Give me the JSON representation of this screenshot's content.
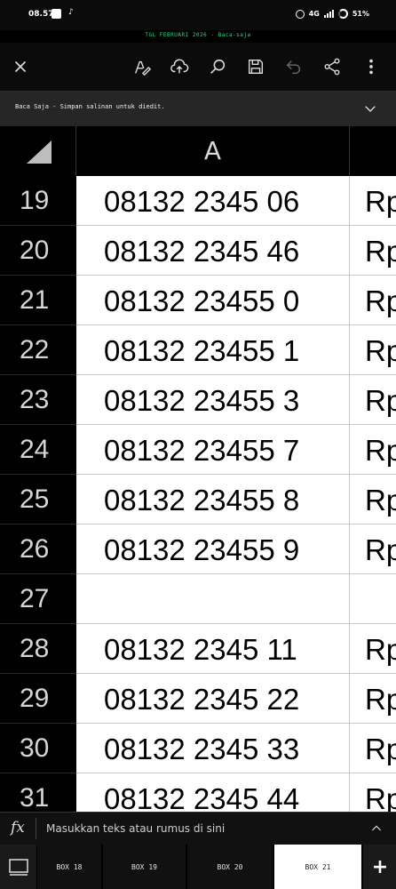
{
  "status_bar": {
    "time": "08.57",
    "network": "4G",
    "battery": "51%"
  },
  "doc_title": "TGL FEBRUARI 2026 - Baca-saja",
  "info_bar": {
    "text": "Baca Saja - Simpan salinan untuk diedit."
  },
  "sheet": {
    "column_header": "A",
    "rows": [
      {
        "num": "19",
        "a": "08132 2345 06",
        "b": "Rp"
      },
      {
        "num": "20",
        "a": "08132 2345 46",
        "b": "Rp"
      },
      {
        "num": "21",
        "a": "08132 23455 0",
        "b": "Rp"
      },
      {
        "num": "22",
        "a": "08132 23455 1",
        "b": "Rp"
      },
      {
        "num": "23",
        "a": "08132 23455 3",
        "b": "Rp"
      },
      {
        "num": "24",
        "a": "08132 23455 7",
        "b": "Rp"
      },
      {
        "num": "25",
        "a": "08132 23455 8",
        "b": "Rp"
      },
      {
        "num": "26",
        "a": "08132 23455 9",
        "b": "Rp"
      },
      {
        "num": "27",
        "a": "",
        "b": ""
      },
      {
        "num": "28",
        "a": "08132 2345 11",
        "b": "Rp"
      },
      {
        "num": "29",
        "a": "08132 2345 22",
        "b": "Rp"
      },
      {
        "num": "30",
        "a": "08132 2345 33",
        "b": "Rp"
      },
      {
        "num": "31",
        "a": "08132 2345 44",
        "b": "Rp"
      }
    ]
  },
  "formula_bar": {
    "icon_label": "fx",
    "placeholder": "Masukkan teks atau rumus di sini"
  },
  "tabs": [
    {
      "label": "BOX 18",
      "active": false
    },
    {
      "label": "BOX 19",
      "active": false
    },
    {
      "label": "BOX 20",
      "active": false
    },
    {
      "label": "BOX 21",
      "active": true
    }
  ],
  "add_sheet_label": "+",
  "colors": {
    "title_green": "#3fd28a",
    "background": "#000000",
    "cell_bg": "#ffffff"
  }
}
